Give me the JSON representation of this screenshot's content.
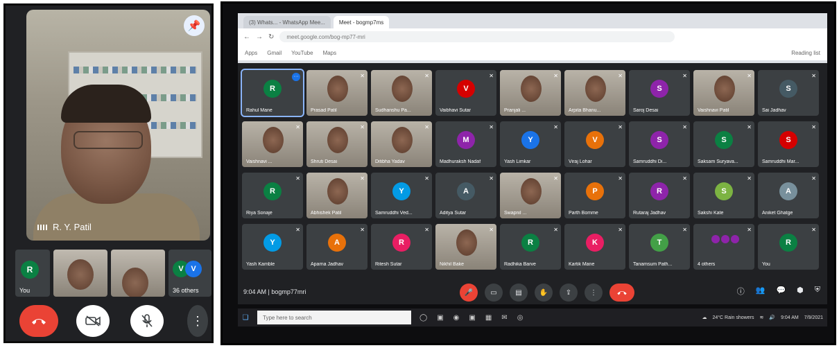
{
  "phone": {
    "main_speaker_name": "R. Y. Patil",
    "pin_icon": "pin-icon",
    "thumbnails": [
      {
        "kind": "avatar",
        "initial": "R",
        "label": "You",
        "color": "#0b8043"
      },
      {
        "kind": "camera",
        "label": ""
      },
      {
        "kind": "camera",
        "label": ""
      },
      {
        "kind": "others",
        "initials": [
          "V",
          "V"
        ],
        "colors": [
          "#0b8043",
          "#1a73e8"
        ],
        "label": "36 others"
      }
    ],
    "controls": {
      "end_call_icon": "phone-hangup-icon",
      "camera_icon": "camera-off-icon",
      "mic_icon": "mic-off-icon",
      "more_icon": "more-vert-icon",
      "more_glyph": "⋮"
    }
  },
  "browser": {
    "tabs": [
      "(3) Whats... - WhatsApp Mee...",
      "Meet - bogmp7ms"
    ],
    "url": "meet.google.com/bog-mp77-mri",
    "bookmarks": [
      "Apps",
      "Gmail",
      "YouTube",
      "Maps"
    ],
    "reading_list": "Reading list"
  },
  "meet": {
    "participants": [
      {
        "name": "Rahul Mane",
        "initial": "R",
        "color": "#0b8043",
        "cam": false,
        "selected": true
      },
      {
        "name": "Prasad Patil",
        "cam": true
      },
      {
        "name": "Sudhanshu Pa...",
        "cam": true
      },
      {
        "name": "Vaibhavi Sutar",
        "initial": "V",
        "color": "#d50000",
        "cam": false
      },
      {
        "name": "Pranjali ...",
        "cam": true
      },
      {
        "name": "Arpita Bhanu...",
        "cam": true
      },
      {
        "name": "Saroj Desai",
        "initial": "S",
        "color": "#8e24aa",
        "cam": false
      },
      {
        "name": "Vaishnavi Patil",
        "cam": true
      },
      {
        "name": "Sai Jadhav",
        "initial": "S",
        "color": "#455a64",
        "cam": false
      },
      {
        "name": "Vaishnavi ...",
        "cam": true
      },
      {
        "name": "Shruti Desai",
        "cam": true
      },
      {
        "name": "Ditibha Yadav",
        "cam": true
      },
      {
        "name": "Madhuraksh Nadaf",
        "initial": "M",
        "color": "#8e24aa",
        "cam": false
      },
      {
        "name": "Yash Limkar",
        "initial": "Y",
        "color": "#1a73e8",
        "cam": false
      },
      {
        "name": "Viraj Lohar",
        "initial": "V",
        "color": "#e8710a",
        "cam": false
      },
      {
        "name": "Samruddhi Di...",
        "initial": "S",
        "color": "#8e24aa",
        "cam": false
      },
      {
        "name": "Saksam Suryava...",
        "initial": "S",
        "color": "#0b8043",
        "cam": false
      },
      {
        "name": "Samruddhi Mar...",
        "initial": "S",
        "color": "#d50000",
        "cam": false
      },
      {
        "name": "Riya Sonaje",
        "initial": "R",
        "color": "#0b8043",
        "cam": false
      },
      {
        "name": "Abhishek Patil",
        "cam": true
      },
      {
        "name": "Samruddhi Ved...",
        "initial": "Y",
        "color": "#039be5",
        "cam": false
      },
      {
        "name": "Aditya Sutar",
        "initial": "A",
        "color": "#455a64",
        "cam": false
      },
      {
        "name": "Swapnil ...",
        "cam": true
      },
      {
        "name": "Parth Bomme",
        "initial": "P",
        "color": "#e8710a",
        "cam": false
      },
      {
        "name": "Rutaraj Jadhav",
        "initial": "R",
        "color": "#8e24aa",
        "cam": false
      },
      {
        "name": "Sakshi Kate",
        "initial": "S",
        "color": "#7cb342",
        "cam": false
      },
      {
        "name": "Aniket Ghatge",
        "initial": "A",
        "color": "#78909c",
        "cam": false
      },
      {
        "name": "Yash Kamble",
        "initial": "Y",
        "color": "#039be5",
        "cam": false
      },
      {
        "name": "Aparna Jadhav",
        "initial": "A",
        "color": "#e8710a",
        "cam": false
      },
      {
        "name": "Ritesh Sutar",
        "initial": "R",
        "color": "#e91e63",
        "cam": false
      },
      {
        "name": "Nikhil Bake",
        "initial": "N",
        "color": "#5e35b1",
        "cam": true
      },
      {
        "name": "Radhika Barve",
        "initial": "R",
        "color": "#0b8043",
        "cam": false
      },
      {
        "name": "Kartik Mane",
        "initial": "K",
        "color": "#e91e63",
        "cam": false
      },
      {
        "name": "Tanamsum Path...",
        "initial": "T",
        "color": "#43a047",
        "cam": false
      },
      {
        "name": "4 others",
        "others": true
      },
      {
        "name": "You",
        "initial": "R",
        "color": "#0b8043",
        "cam": false
      }
    ],
    "bar": {
      "time": "9:04 AM",
      "separator": "|",
      "meeting_code": "bogmp77mri",
      "controls": [
        {
          "icon": "mic-off-icon",
          "glyph": "🎤",
          "red": true
        },
        {
          "icon": "camera-icon",
          "glyph": "▭",
          "red": false
        },
        {
          "icon": "captions-icon",
          "glyph": "▤",
          "red": false
        },
        {
          "icon": "hand-raise-icon",
          "glyph": "✋",
          "red": false
        },
        {
          "icon": "present-icon",
          "glyph": "⇪",
          "red": false
        },
        {
          "icon": "more-vert-icon",
          "glyph": "⋮",
          "red": false
        }
      ],
      "end_icon": "phone-hangup-icon",
      "right_icons": [
        {
          "icon": "info-icon",
          "glyph": "ⓘ"
        },
        {
          "icon": "people-icon",
          "glyph": "👥"
        },
        {
          "icon": "chat-icon",
          "glyph": "💬"
        },
        {
          "icon": "activities-icon",
          "glyph": "⬢"
        },
        {
          "icon": "security-icon",
          "glyph": "⛨"
        }
      ]
    }
  },
  "taskbar": {
    "search_placeholder": "Type here to search",
    "weather": "24°C  Rain showers",
    "clock_time": "9:04 AM",
    "clock_date": "7/9/2021"
  }
}
